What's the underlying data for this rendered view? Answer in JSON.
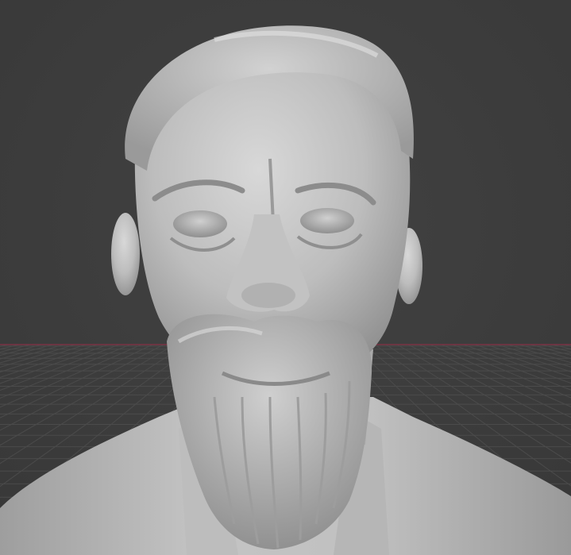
{
  "viewport": {
    "background_color": "#3d3d3d",
    "grid_line_color": "#4a4a4a",
    "x_axis_color": "#8a3a4a",
    "sculpt_base_color": "#b9b9b9",
    "sculpt_highlight_color": "#d6d6d6",
    "sculpt_shadow_color": "#7a7a7a",
    "object": "bust-sculpt-mesh",
    "shading": "solid-matcap"
  }
}
